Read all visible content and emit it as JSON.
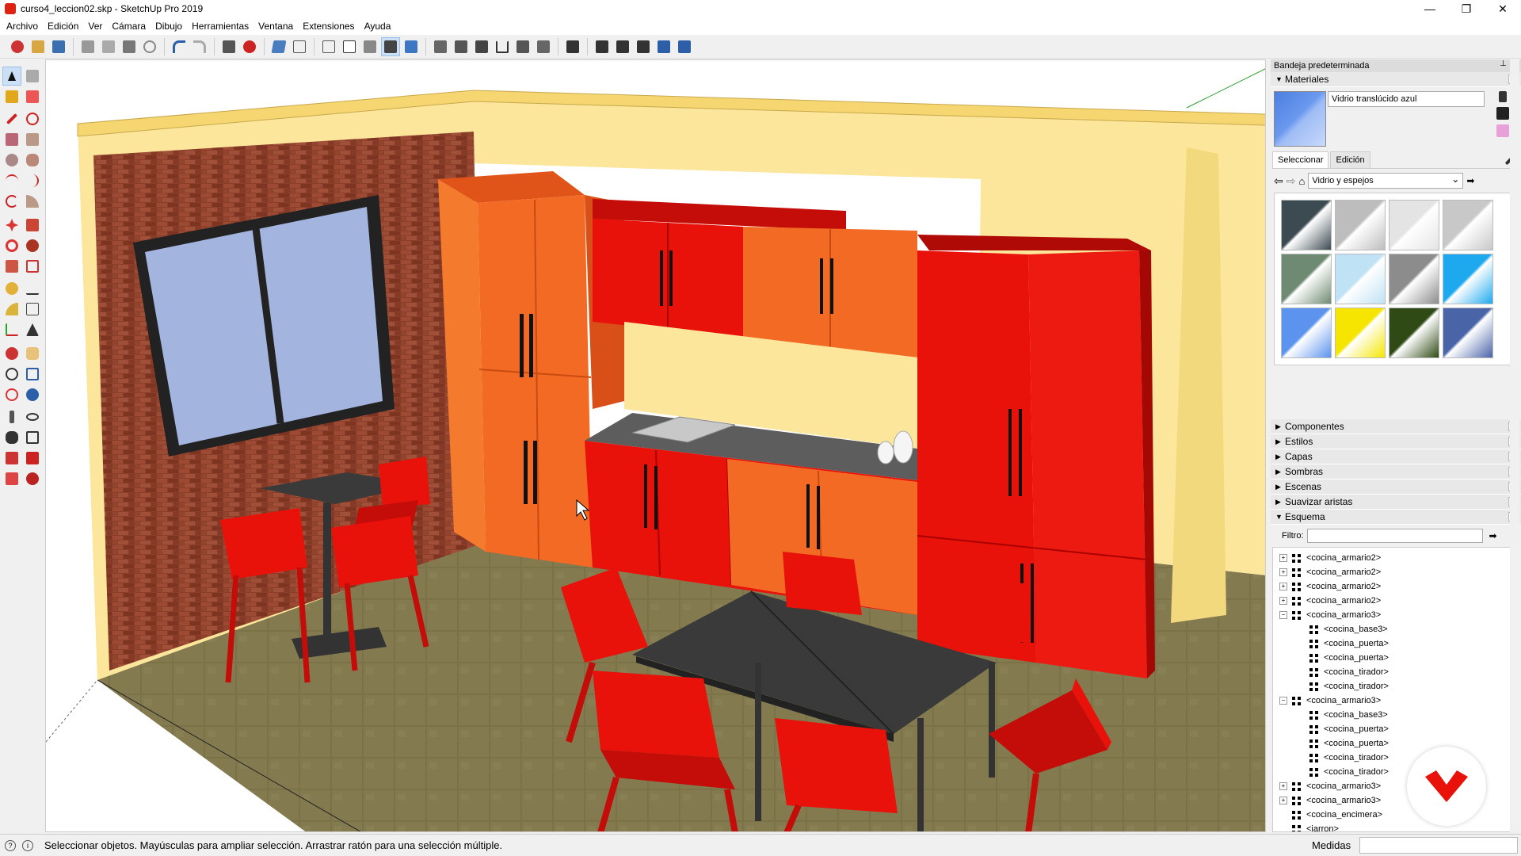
{
  "window": {
    "title": "curso4_leccion02.skp - SketchUp Pro 2019",
    "minimize_glyph": "—",
    "maximize_glyph": "❐",
    "close_glyph": "✕"
  },
  "menu": [
    "Archivo",
    "Edición",
    "Ver",
    "Cámara",
    "Dibujo",
    "Herramientas",
    "Ventana",
    "Extensiones",
    "Ayuda"
  ],
  "tray": {
    "title": "Bandeja predeterminada",
    "materials": {
      "header": "Materiales",
      "current_material": "Vidrio translúcido azul",
      "tab_select": "Seleccionar",
      "tab_edit": "Edición",
      "library": "Vidrio y espejos",
      "swatch_colors": [
        "#3c4a52",
        "#bdbdbd",
        "#e4e4e4",
        "#c8c8c8",
        "#6f8a72",
        "#bfe2f4",
        "#8c8c8c",
        "#1ea9ee",
        "#5b93ee",
        "#f5e500",
        "#2f4a14",
        "#4a64a8"
      ]
    },
    "collapsed_sections": [
      "Componentes",
      "Estilos",
      "Capas",
      "Sombras",
      "Escenas",
      "Suavizar aristas"
    ],
    "outline": {
      "header": "Esquema",
      "filter_label": "Filtro:",
      "rows": [
        {
          "label": "<cocina_armario2>",
          "level": 0,
          "exp": "+"
        },
        {
          "label": "<cocina_armario2>",
          "level": 0,
          "exp": "+"
        },
        {
          "label": "<cocina_armario2>",
          "level": 0,
          "exp": "+"
        },
        {
          "label": "<cocina_armario2>",
          "level": 0,
          "exp": "+"
        },
        {
          "label": "<cocina_armario3>",
          "level": 0,
          "exp": "−"
        },
        {
          "label": "<cocina_base3>",
          "level": 1,
          "exp": ""
        },
        {
          "label": "<cocina_puerta>",
          "level": 1,
          "exp": ""
        },
        {
          "label": "<cocina_puerta>",
          "level": 1,
          "exp": ""
        },
        {
          "label": "<cocina_tirador>",
          "level": 1,
          "exp": ""
        },
        {
          "label": "<cocina_tirador>",
          "level": 1,
          "exp": ""
        },
        {
          "label": "<cocina_armario3>",
          "level": 0,
          "exp": "−"
        },
        {
          "label": "<cocina_base3>",
          "level": 1,
          "exp": ""
        },
        {
          "label": "<cocina_puerta>",
          "level": 1,
          "exp": ""
        },
        {
          "label": "<cocina_puerta>",
          "level": 1,
          "exp": ""
        },
        {
          "label": "<cocina_tirador>",
          "level": 1,
          "exp": ""
        },
        {
          "label": "<cocina_tirador>",
          "level": 1,
          "exp": ""
        },
        {
          "label": "<cocina_armario3>",
          "level": 0,
          "exp": "+"
        },
        {
          "label": "<cocina_armario3>",
          "level": 0,
          "exp": "+"
        },
        {
          "label": "<cocina_encimera>",
          "level": 0,
          "exp": ""
        },
        {
          "label": "<jarron>",
          "level": 0,
          "exp": ""
        }
      ]
    }
  },
  "status": {
    "text": "Seleccionar objetos. Mayúsculas para ampliar selección. Arrastrar ratón para una selección múltiple.",
    "measures_label": "Medidas"
  },
  "scene": {
    "brick_color": "#8b3f2a",
    "wall_color": "#fbe69b",
    "floor_color": "#7b7248",
    "cabinet_orange": "#f26a24",
    "cabinet_red": "#e8120a",
    "table_color": "#3a3a3a",
    "window_glass": "#a3b4de"
  }
}
